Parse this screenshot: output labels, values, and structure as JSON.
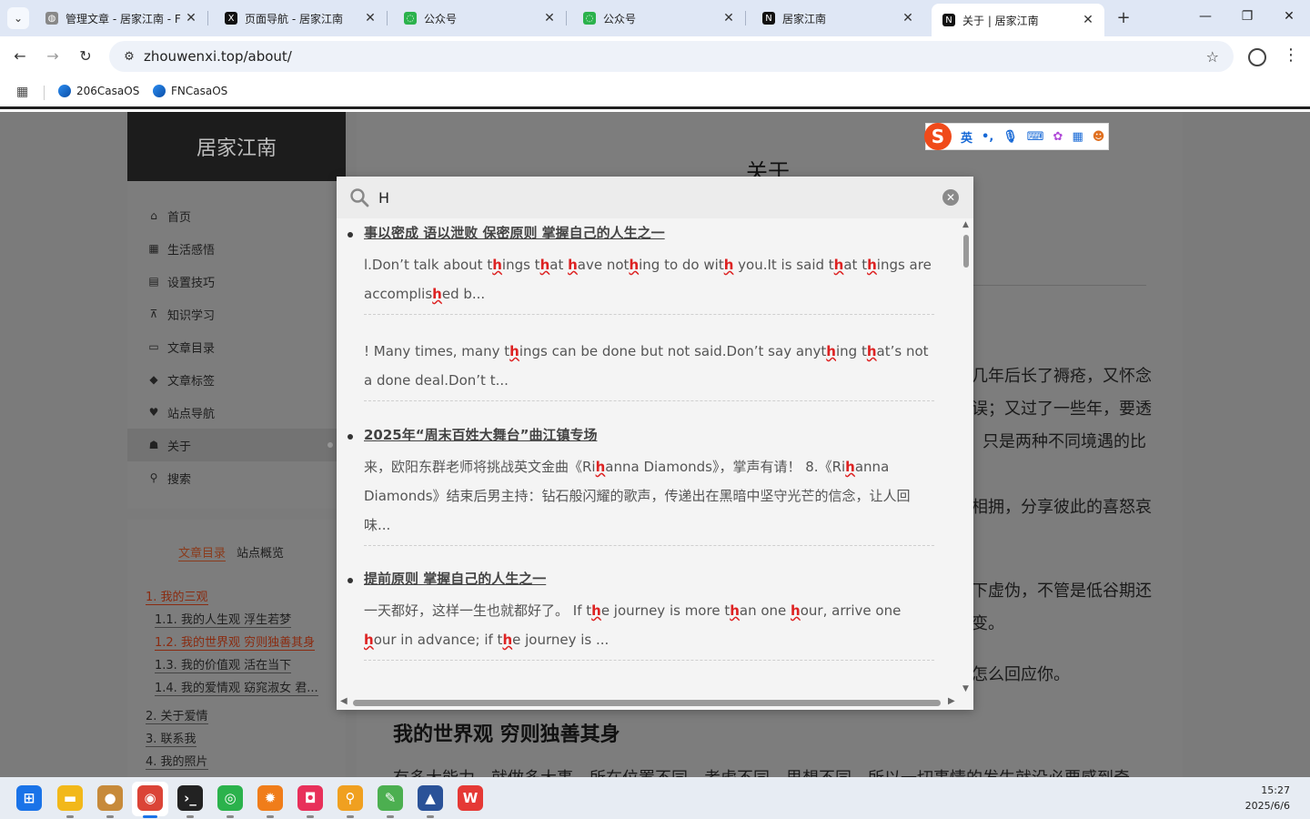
{
  "browser": {
    "tabs": [
      {
        "title": "管理文章 - 居家江南 - F",
        "favicon": "globe-icon"
      },
      {
        "title": "页面导航 - 居家江南",
        "favicon": "x-logo-icon"
      },
      {
        "title": "公众号",
        "favicon": "wechat-icon"
      },
      {
        "title": "公众号",
        "favicon": "wechat-icon"
      },
      {
        "title": "居家江南",
        "favicon": "n-logo-icon"
      },
      {
        "title": "关于 | 居家江南",
        "favicon": "n-logo-icon",
        "active": true
      }
    ],
    "url": "zhouwenxi.top/about/",
    "bookmarks": [
      "206CasaOS",
      "FNCasaOS"
    ]
  },
  "site": {
    "title": "居家江南",
    "menu": [
      {
        "label": "首页",
        "icon": "home-icon"
      },
      {
        "label": "生活感悟",
        "icon": "grid-icon"
      },
      {
        "label": "设置技巧",
        "icon": "calendar-icon"
      },
      {
        "label": "知识学习",
        "icon": "sitemap-icon"
      },
      {
        "label": "文章目录",
        "icon": "archive-icon"
      },
      {
        "label": "文章标签",
        "icon": "tags-icon"
      },
      {
        "label": "站点导航",
        "icon": "heart-icon"
      },
      {
        "label": "关于",
        "icon": "user-icon",
        "active": true
      },
      {
        "label": "搜索",
        "icon": "search-icon"
      }
    ],
    "toc_tabs": [
      "文章目录",
      "站点概览"
    ],
    "toc": [
      "1. 我的三观",
      "1.1. 我的人生观 浮生若梦",
      "1.2. 我的世界观 穷则独善其身",
      "1.3. 我的价值观 活在当下",
      "1.4. 我的爱情观 窈窕淑女 君...",
      "2. 关于爱情",
      "3. 联系我",
      "4. 我的照片"
    ]
  },
  "article": {
    "title": "关于",
    "fragments": [
      "几年后长了褥疮，又怀念",
      "误；又过了一些年，要透",
      "只是两种不同境遇的比",
      "相拥，分享彼此的喜怒哀",
      "下虚伪，不管是低谷期还",
      "变。",
      "怎么回应你。"
    ],
    "heading2": "我的世界观 穷则独善其身",
    "para2": "有多大能力，就做多大事，所在位置不同，考虑不同，思想不同，所以一切事情的发生就没必要感到奇"
  },
  "search": {
    "query": "H",
    "results": [
      {
        "title": "事以密成 语以泄败 保密原则 掌握自己的人生之一",
        "snippets": [
          "l.Don’t talk about t[h]ings t[h]at [h]ave not[h]ing to do wit[h] you.It is said t[h]at t[h]ings are accomplis[h]ed b...",
          "! Many times, many t[h]ings can be done but not said.Don’t say anyt[h]ing t[h]at’s not a done deal.Don’t t..."
        ]
      },
      {
        "title": "2025年“周末百姓大舞台”曲江镇专场",
        "snippets": [
          "来，欧阳东群老师将挑战英文金曲《Ri[h]anna Diamonds》，掌声有请！ 8.《Ri[h]anna Diamonds》结束后男主持：钻石般闪耀的歌声，传递出在黑暗中坚守光芒的信念，让人回味..."
        ]
      },
      {
        "title": "提前原则 掌握自己的人生之一",
        "snippets": [
          "一天都好，这样一生也就都好了。 If t[h]e journey is more t[h]an one [h]our, arrive one [h]our in advance; if t[h]e journey is ..."
        ]
      }
    ]
  },
  "ime": {
    "mode": "英",
    "icons": [
      "punct-icon",
      "mic-icon",
      "keyboard-icon",
      "skin-icon",
      "toolbox-icon",
      "mascot-icon"
    ]
  },
  "taskbar": {
    "apps": [
      "start-icon",
      "file-explorer-icon",
      "acorn-icon",
      "chrome-icon",
      "terminal-icon",
      "wechat-icon",
      "pinwheel-icon",
      "app-store-icon",
      "search-tool-icon",
      "notepad-icon",
      "mountain-icon",
      "wps-icon"
    ],
    "time": "15:27",
    "date": "2025/6/6"
  },
  "colors": {
    "accent": "#d22222",
    "link": "#8a2b10",
    "sidebar_head": "#1c1c1c"
  }
}
